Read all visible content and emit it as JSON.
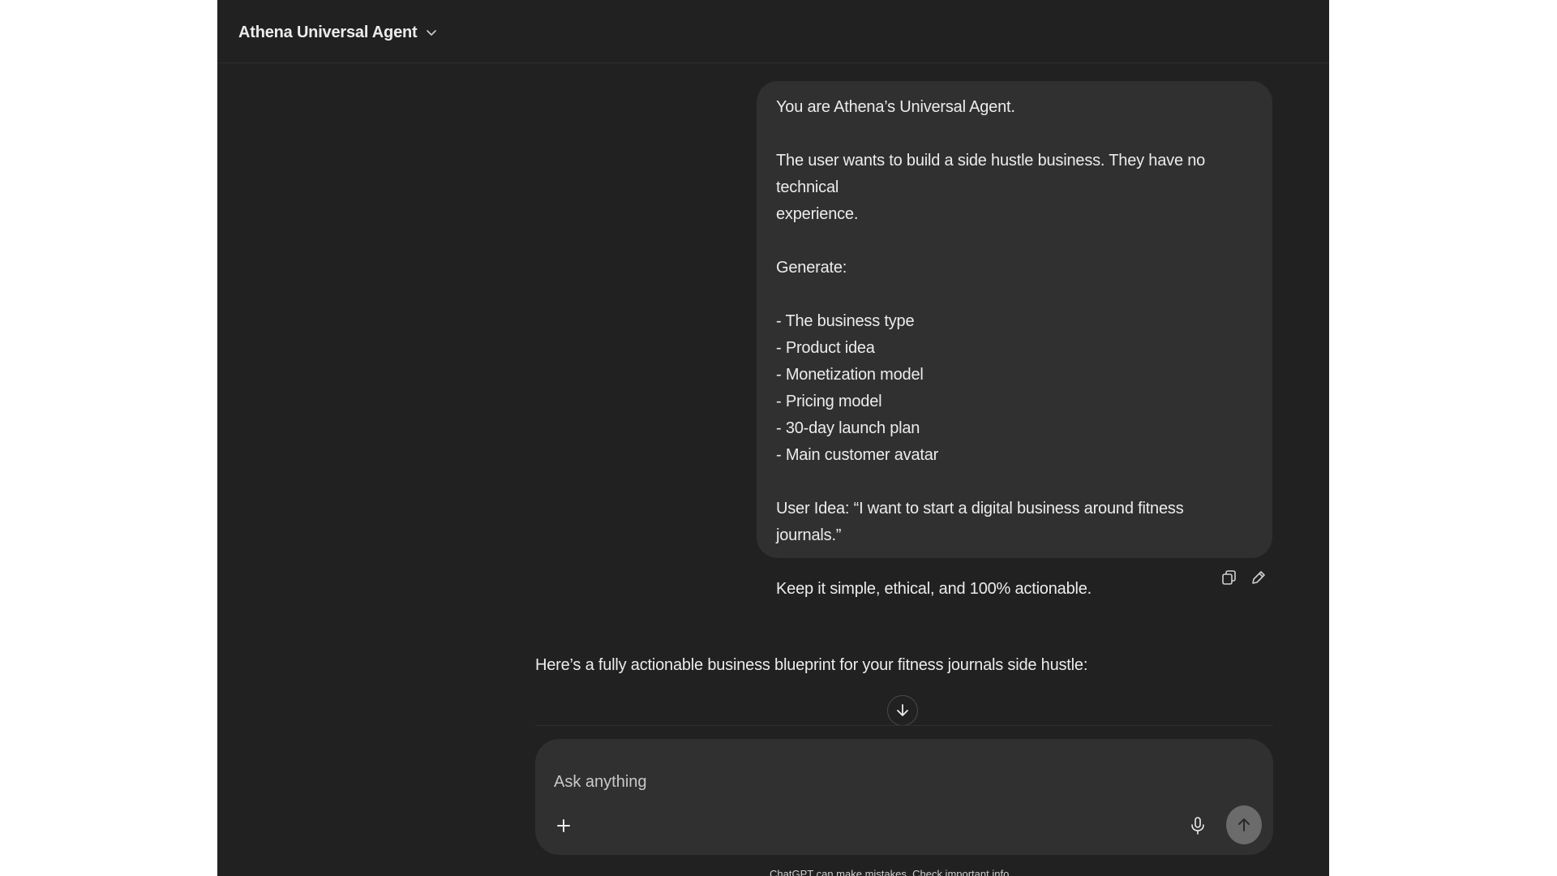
{
  "header": {
    "model_name": "Athena Universal Agent",
    "dropdown_icon": "chevron-down-icon"
  },
  "conversation": {
    "user_message": {
      "lines": [
        "You are Athena’s Universal Agent.",
        "",
        "The user wants to build a side hustle business. They have no technical",
        "experience.",
        "",
        "Generate:",
        "",
        "- The business type",
        "- Product idea",
        "- Monetization model",
        "- Pricing model",
        "- 30-day launch plan",
        "- Main customer avatar",
        "",
        "User Idea: “I want to start a digital business around fitness journals.”",
        "",
        "Keep it simple, ethical, and 100% actionable."
      ],
      "actions": [
        "copy-icon",
        "edit-icon"
      ]
    },
    "assistant_message": "Here’s a fully actionable business blueprint for your fitness journals side hustle:"
  },
  "composer": {
    "placeholder": "Ask anything",
    "value": "",
    "icons": [
      "plus-icon",
      "microphone-icon",
      "arrow-up-icon"
    ]
  },
  "footer": {
    "disclaimer": "ChatGPT can make mistakes. Check important info."
  },
  "colors": {
    "background": "#212121",
    "bubble": "#303030",
    "text": "#ececec",
    "send_button": "#6b6b6b"
  }
}
